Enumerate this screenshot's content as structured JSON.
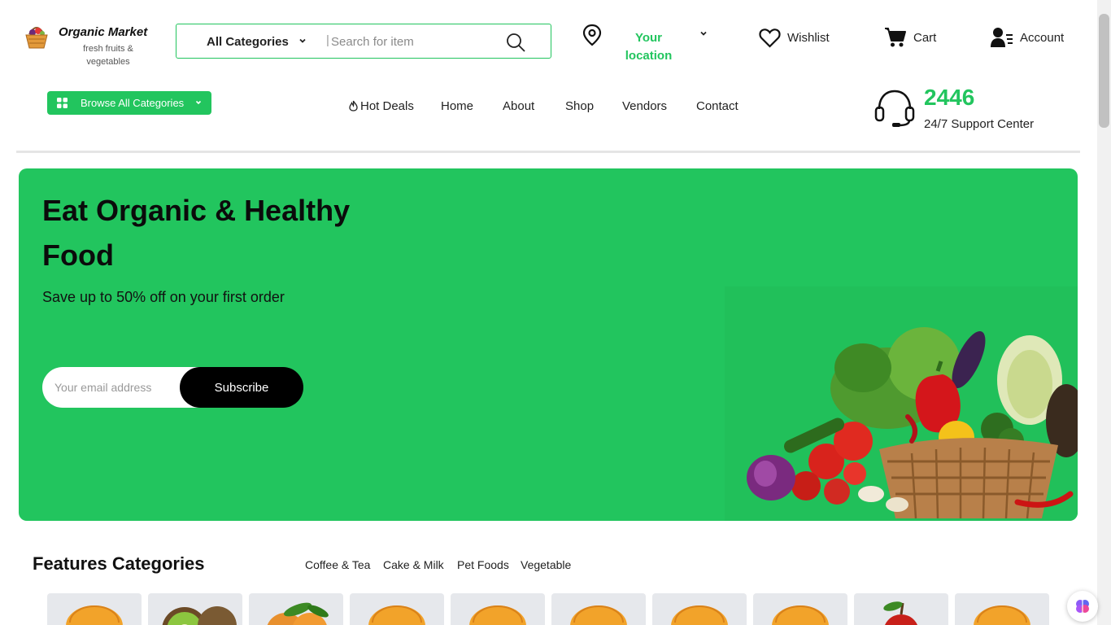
{
  "brand": {
    "name": "Organic Market",
    "tagline": "fresh fruits & vegetables"
  },
  "search": {
    "category": "All Categories",
    "separator": "|",
    "placeholder": "Search for item"
  },
  "location": {
    "label": "Your location"
  },
  "header": {
    "wishlist": "Wishlist",
    "cart": "Cart",
    "account": "Account"
  },
  "nav": {
    "browse": "Browse All Categories",
    "items": [
      "Hot Deals",
      "Home",
      "About",
      "Shop",
      "Vendors",
      "Contact"
    ]
  },
  "support": {
    "number": "2446",
    "label": "24/7 Support Center"
  },
  "hero": {
    "title": "Eat Organic & Healthy Food",
    "subtitle": "Save up to 50% off on your first order",
    "email_placeholder": "Your email address",
    "subscribe": "Subscribe"
  },
  "features": {
    "title": "Features Categories",
    "tabs": [
      "Coffee & Tea",
      "Cake & Milk",
      "Pet Foods",
      "Vegetable"
    ],
    "cards": [
      "burger-icon",
      "kiwi-icon",
      "peach-icon",
      "burger-icon",
      "burger-icon",
      "burger-icon",
      "burger-icon",
      "burger-icon",
      "apple-icon",
      "burger-icon"
    ]
  },
  "colors": {
    "accent": "#22c55e",
    "dark": "#000000",
    "card_bg": "#e6e8ec"
  }
}
